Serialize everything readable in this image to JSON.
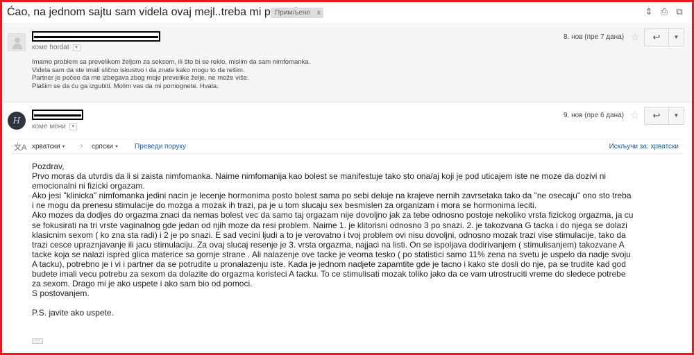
{
  "subject": "Ćao, na jednom sajtu sam videla ovaj mejl..treba mi pomoć",
  "label_chip": {
    "text": "Примљене",
    "close": "x"
  },
  "top_icons": [
    "expand-icon",
    "print-icon",
    "new-window-icon"
  ],
  "message1": {
    "to_label": "коме hordat",
    "date": "8. нов (пре 7 дана)",
    "snippet": [
      "Imamo problem sa prevelikom željom za seksom, ili što bi se reklo, mislim da sam nimfomanka.",
      "Videla sam da ste imali slično iskustvo i da znate kako mogu to da rešim.",
      "Partner je počeo da me izbegava zbog moje prevelike želje, ne može više.",
      "Plašim se da ću ga izgubiti. Molim vas da mi pomognete. Hvala."
    ]
  },
  "message2": {
    "to_label": "коме мени",
    "date": "9. нов (пре 6 дана)",
    "avatar_letter": "H"
  },
  "translate": {
    "from_lang": "хрватски",
    "to_lang": "српски",
    "translate_link": "Преведи поруку",
    "disable_link": "Искључи за: хрватски"
  },
  "body": [
    "Pozdrav,",
    "Prvo moras da utvrdis da li si zaista nimfomanka. Naime nimfomanija kao bolest se manifestuje tako sto ona/aj koji je pod uticajem iste ne moze da dozivi ni",
    "emocionalni ni fizicki orgazam.",
    "Ako jesi \"klinicka\" nimfomanka jedini nacin je lecenje hormonima posto bolest sama po sebi deluje na krajeve nernih zavrsetaka tako da \"ne osecaju\" ono sto treba",
    "i ne mogu da prenesu stimulacije do mozga a mozak ih trazi, pa je u tom slucaju sex besmislen za organizam i mora se hormonima leciti.",
    "Ako mozes da dodjes do orgazma znaci da nemas bolest vec da samo taj orgazam nije dovoljno jak za tebe odnosno postoje nekoliko vrsta fizickog orgazma, ja cu",
    "se fokusirati na tri vrste vaginalnog gde jedan od njih moze da resi problem. Naime 1. je klitorisni odnosno 3 po snazi. 2. je takozvana G tacka i do njega se dolazi",
    "klasicnim sexom ( ko zna sta radi) i 2 je po snazi. E sad vecini ljudi a to je verovatno i tvoj problem ovi nisu dovoljni, odnosno mozak trazi vise stimulacije, tako da",
    "trazi cesce upraznjavanje ili jacu stimulaciju. Za ovaj slucaj resenje je 3. vrsta orgazma, najjaci na listi. On se ispoljava dodirivanjem ( stimulisanjem) takozvane A",
    "tacke koja se nalazi ispred glica materice sa gornje strane . Ali nalazenje ove tacke je veoma tesko ( po statistici samo 11% zena na svetu je uspelo da nadje svoju",
    "A tacku), potrebno je i vi i partner da se potrudite u pronalazenju iste. Kada je jednom nadjete zapamtite gde je tacno i kako ste dosli do nje, pa se trudite kad god",
    "budete imali vecu potrebu za sexom da dolazite do orgazma koristeci A tacku. To ce stimulisati mozak toliko jako da ce vam utrostruciti vreme do sledece potrebe",
    "za sexom. Drago mi je ako uspete i ako sam bio od pomoci.",
    "S postovanjem.",
    "",
    "P.S. javite ako uspete."
  ],
  "reply_icon": "reply-arrow-icon",
  "more_icon": "chevron-down-icon"
}
